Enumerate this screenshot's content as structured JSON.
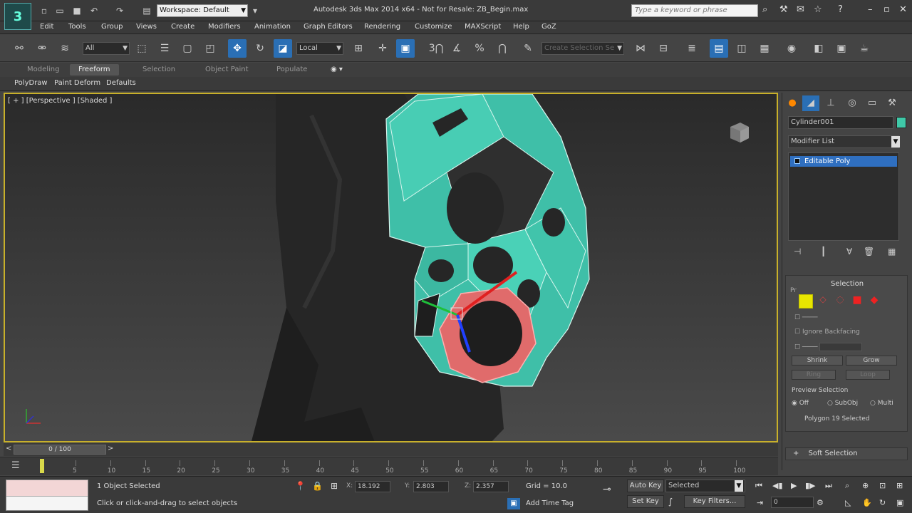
{
  "titlebar": {
    "app_logo": "3",
    "workspace": "Workspace: Default",
    "title": "Autodesk 3ds Max 2014 x64   - Not for Resale:   ZB_Begin.max",
    "search_placeholder": "Type a keyword or phrase"
  },
  "menu": [
    "Edit",
    "Tools",
    "Group",
    "Views",
    "Create",
    "Modifiers",
    "Animation",
    "Graph Editors",
    "Rendering",
    "Customize",
    "MAXScript",
    "Help",
    "GoZ"
  ],
  "toolbar": {
    "selection_filter": "All",
    "ref_coord": "Local",
    "named_selection": "Create Selection Se",
    "snap_label": "3"
  },
  "ribbon": {
    "tabs": [
      "Modeling",
      "Freeform",
      "Selection",
      "Object Paint",
      "Populate"
    ],
    "active_tab": "Freeform",
    "subtabs": [
      "PolyDraw",
      "Paint Deform",
      "Defaults"
    ]
  },
  "viewport": {
    "label": "[ + ] [Perspective ] [Shaded ]"
  },
  "command_panel": {
    "object_name": "Cylinder001",
    "object_color": "#3fc9a8",
    "modifier_list": "Modifier List",
    "stack_item": "Editable Poly",
    "rollout_title": "Selection",
    "rollout_short": "Pr",
    "ignore_backfacing": "Ignore Backfacing",
    "shrink": "Shrink",
    "grow": "Grow",
    "ring": "Ring",
    "loop": "Loop",
    "preview_title": "Preview Selection",
    "preview_off": "Off",
    "preview_subobj": "SubObj",
    "preview_multi": "Multi",
    "selection_status": "Polygon 19 Selected",
    "soft_selection": "Soft Selection"
  },
  "timeline": {
    "frame": "0 / 100",
    "ticks": [
      "5",
      "10",
      "15",
      "20",
      "25",
      "30",
      "35",
      "40",
      "45",
      "50",
      "55",
      "60",
      "65",
      "70",
      "75",
      "80",
      "85",
      "90",
      "95",
      "100"
    ]
  },
  "status": {
    "objects_selected": "1 Object Selected",
    "prompt": "Click or click-and-drag to select objects",
    "x_label": "X:",
    "x": "18.192",
    "y_label": "Y:",
    "y": "2.803",
    "z_label": "Z:",
    "z": "2.357",
    "grid": "Grid = 10.0",
    "auto_key": "Auto Key",
    "set_key": "Set Key",
    "key_mode": "Selected",
    "key_filters": "Key Filters...",
    "add_time_tag": "Add Time Tag",
    "current_frame": "0"
  }
}
